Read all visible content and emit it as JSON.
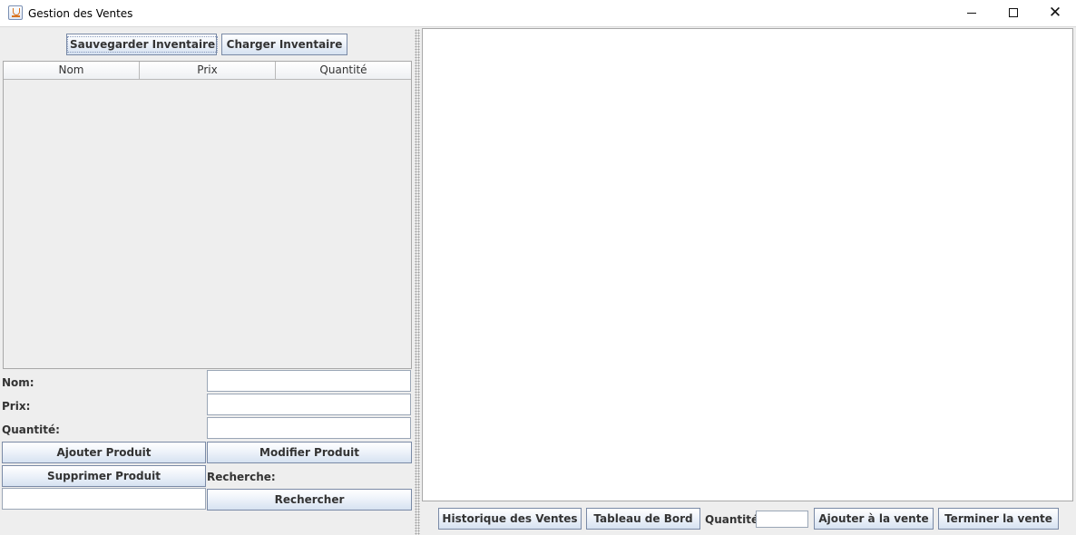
{
  "window": {
    "title": "Gestion des Ventes",
    "minimize": "",
    "maximize": "",
    "close": "✕"
  },
  "inventory": {
    "save_label": "Sauvegarder Inventaire",
    "load_label": "Charger Inventaire"
  },
  "table": {
    "columns": [
      "Nom",
      "Prix",
      "Quantité"
    ],
    "rows": []
  },
  "form": {
    "name_label": "Nom:",
    "name_value": "",
    "price_label": "Prix:",
    "price_value": "",
    "qty_label": "Quantité:",
    "qty_value": "",
    "add_label": "Ajouter Produit",
    "edit_label": "Modifier Produit",
    "delete_label": "Supprimer Produit",
    "search_label": "Recherche:",
    "search_value": "",
    "search_button_label": "Rechercher"
  },
  "sales": {
    "history_label": "Historique des Ventes",
    "dashboard_label": "Tableau de Bord",
    "qty_label": "Quantité:",
    "qty_value": "",
    "add_to_sale_label": "Ajouter à la vente",
    "finish_sale_label": "Terminer la vente"
  }
}
